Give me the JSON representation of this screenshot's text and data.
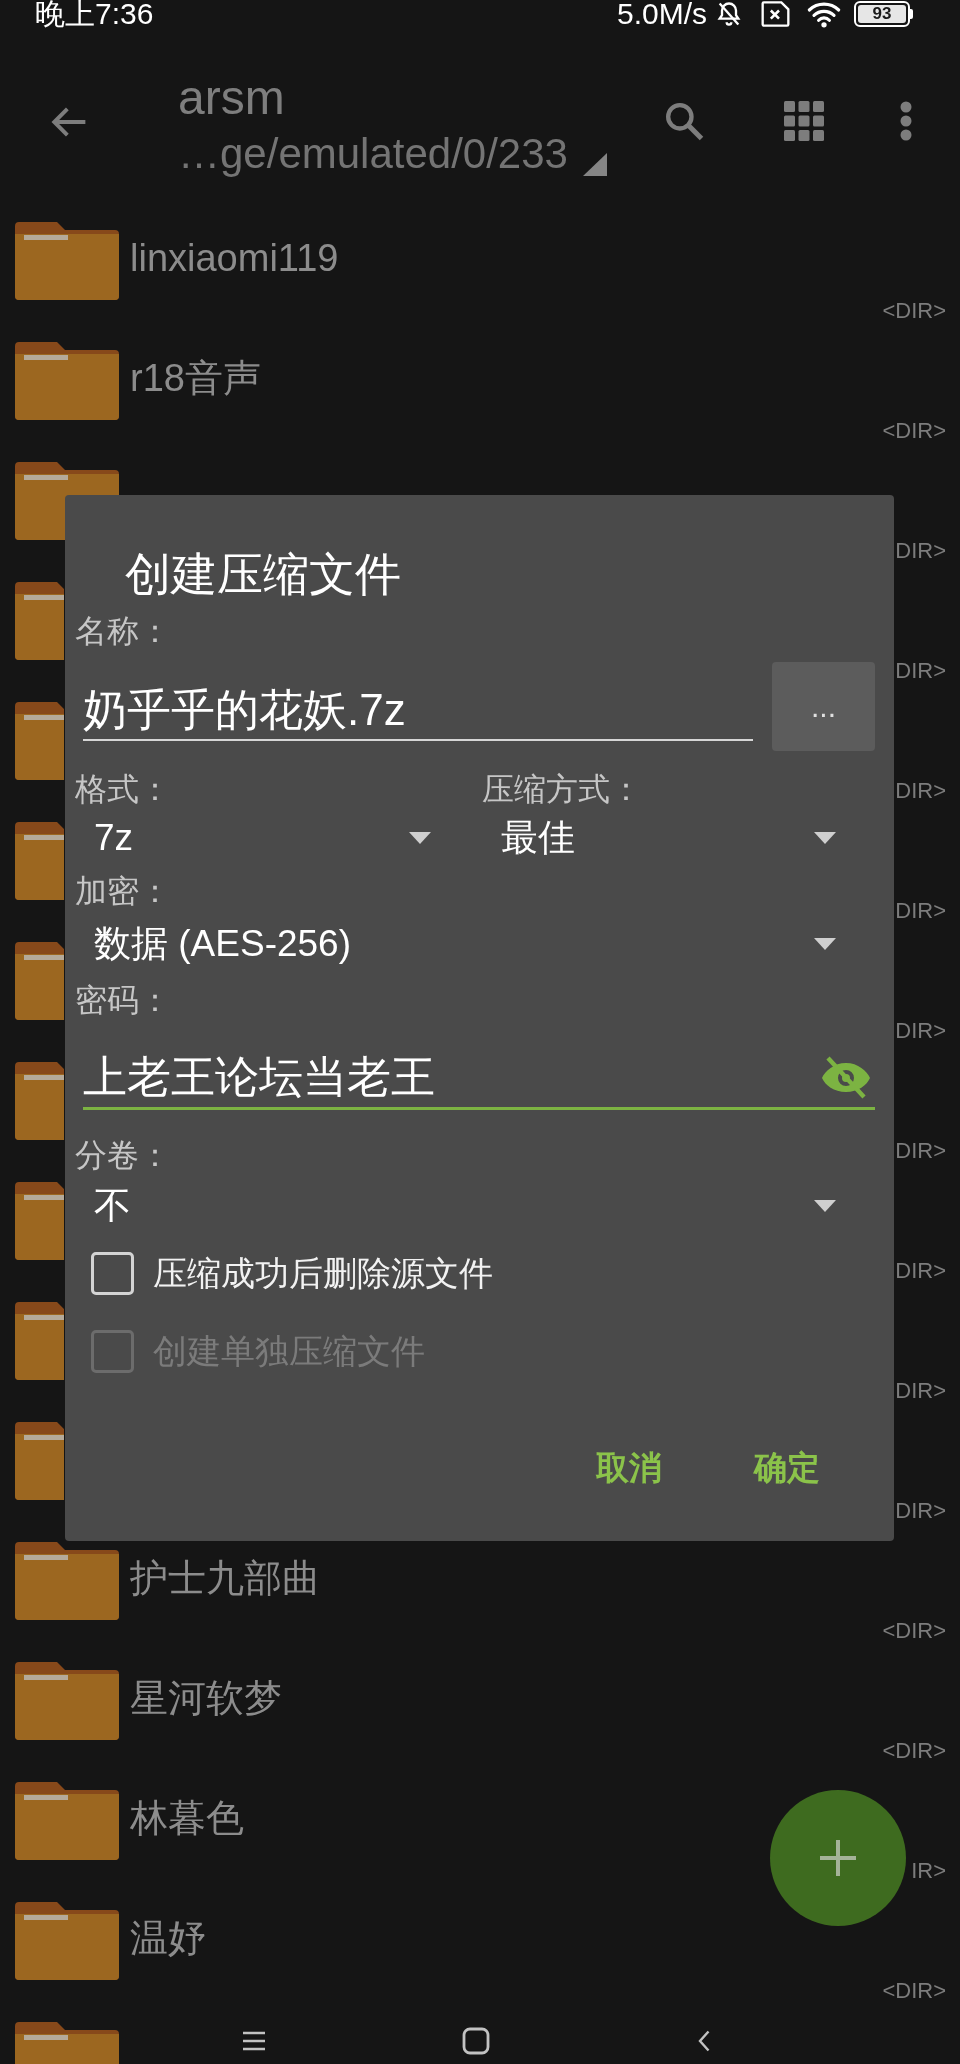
{
  "status_bar": {
    "time": "晚上7:36",
    "net_speed": "5.0M/s",
    "battery": "93"
  },
  "toolbar": {
    "title": "arsm",
    "path": "…ge/emulated/0/233"
  },
  "files": [
    {
      "kind": "folder",
      "name": "linxiaomi119",
      "detail": "<DIR>"
    },
    {
      "kind": "folder",
      "name": "r18音声",
      "detail": "<DIR>"
    },
    {
      "kind": "folder",
      "detail": "DIR>"
    },
    {
      "kind": "folder",
      "detail": "DIR>"
    },
    {
      "kind": "folder",
      "detail": "DIR>"
    },
    {
      "kind": "folder",
      "detail": "DIR>"
    },
    {
      "kind": "folder",
      "detail": "DIR>"
    },
    {
      "kind": "folder",
      "detail": "DIR>"
    },
    {
      "kind": "folder",
      "detail": "DIR>"
    },
    {
      "kind": "folder",
      "detail": "DIR>"
    },
    {
      "kind": "folder",
      "detail": "DIR>"
    },
    {
      "kind": "folder",
      "name": "护士九部曲",
      "detail": "<DIR>"
    },
    {
      "kind": "folder",
      "name": "星河软梦",
      "detail": "<DIR>"
    },
    {
      "kind": "folder",
      "name": "林暮色",
      "detail": "IR>"
    },
    {
      "kind": "folder",
      "name": "温妤",
      "detail": "<DIR>"
    },
    {
      "kind": "folder"
    }
  ],
  "dialog": {
    "title": "创建压缩文件",
    "name": {
      "label": "名称：",
      "value": "奶乎乎的花妖.7z",
      "focused": false,
      "browse": "..."
    },
    "format": {
      "label": "格式：",
      "value": "7z"
    },
    "method": {
      "label": "压缩方式：",
      "value": "最佳"
    },
    "encryption": {
      "label": "加密：",
      "value": "数据 (AES-256)"
    },
    "password": {
      "label": "密码：",
      "value": "上老王论坛当老王",
      "focused": true
    },
    "volumes": {
      "label": "分卷：",
      "value": "不"
    },
    "options": [
      {
        "label": "压缩成功后删除源文件",
        "checked": false,
        "disabled": false
      },
      {
        "label": "创建单独压缩文件",
        "checked": false,
        "disabled": true
      }
    ],
    "buttons": [
      {
        "label": "取消"
      },
      {
        "label": "确定"
      }
    ]
  }
}
